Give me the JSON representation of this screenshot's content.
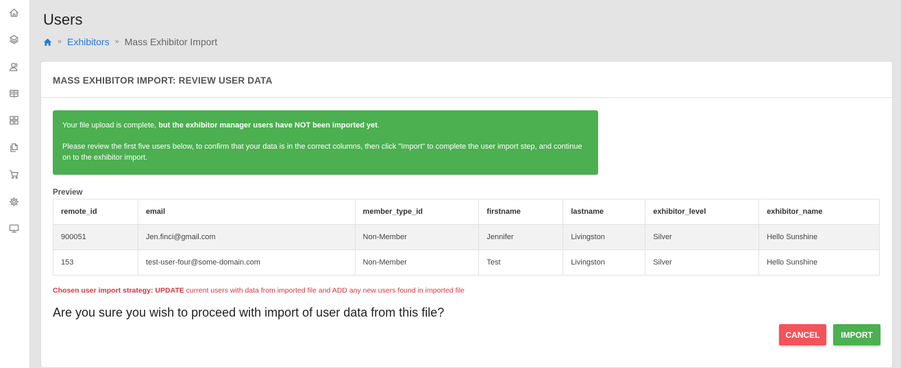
{
  "sidebar": {
    "items": [
      {
        "icon": "home-icon"
      },
      {
        "icon": "layers-icon"
      },
      {
        "icon": "users-icon"
      },
      {
        "icon": "book-icon"
      },
      {
        "icon": "grid-icon"
      },
      {
        "icon": "documents-icon"
      },
      {
        "icon": "cart-icon"
      },
      {
        "icon": "gear-icon"
      },
      {
        "icon": "monitor-icon"
      }
    ]
  },
  "header": {
    "title": "Users",
    "breadcrumb": {
      "separator": "»",
      "link": "Exhibitors",
      "current": "Mass Exhibitor Import"
    }
  },
  "card": {
    "title": "MASS EXHIBITOR IMPORT: REVIEW USER DATA",
    "alert": {
      "line1_prefix": "Your file upload is complete, ",
      "line1_bold": "but the exhibitor manager users have NOT been imported yet",
      "line1_suffix": ".",
      "line2": "Please review the first five users below, to confirm that your data is in the correct columns, then click \"Import\" to complete the user import step, and continue on to the exhibitor import."
    },
    "preview_label": "Preview",
    "table": {
      "headers": [
        "remote_id",
        "email",
        "member_type_id",
        "firstname",
        "lastname",
        "exhibitor_level",
        "exhibitor_name"
      ],
      "rows": [
        [
          "900051",
          "Jen.finci@gmail.com",
          "Non-Member",
          "Jennifer",
          "Livingston",
          "Silver",
          "Hello Sunshine"
        ],
        [
          "153",
          "test-user-four@some-domain.com",
          "Non-Member",
          "Test",
          "Livingston",
          "Silver",
          "Hello Sunshine"
        ]
      ]
    },
    "strategy": {
      "prefix": "Chosen user import strategy: UPDATE",
      "suffix": " current users with data from imported file and ADD any new users found in imported file"
    },
    "question": "Are you sure you wish to proceed with import of user data from this file?",
    "buttons": {
      "cancel": "CANCEL",
      "import": "IMPORT"
    }
  },
  "colors": {
    "alert_bg": "#4caf50",
    "import_button": "#4caf50",
    "cancel_button": "#f25459",
    "link": "#2a7ad8",
    "strategy_text": "#d9363e"
  }
}
